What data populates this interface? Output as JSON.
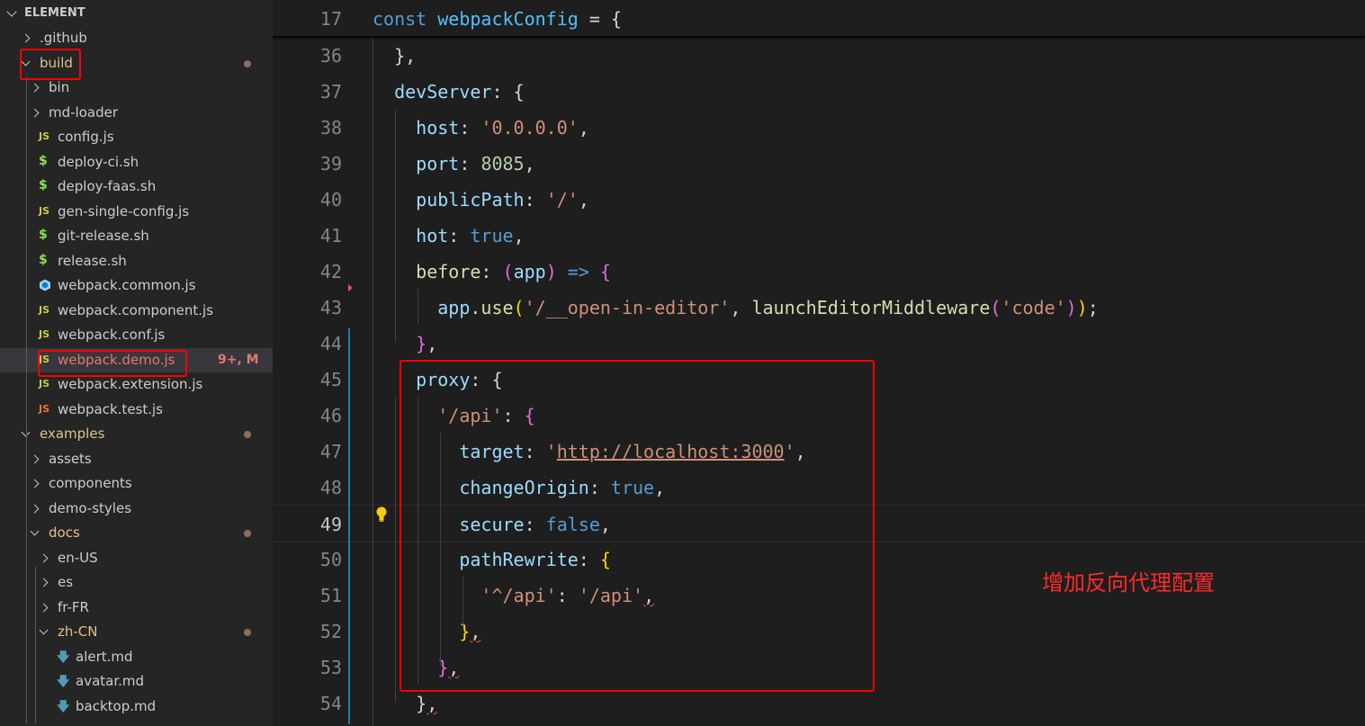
{
  "explorer": {
    "root": "ELEMENT",
    "items": [
      {
        "label": ".github",
        "type": "folder-closed",
        "indent": 0
      },
      {
        "label": "build",
        "type": "folder-open",
        "indent": 0,
        "modified_dot": true
      },
      {
        "label": "bin",
        "type": "folder-closed",
        "indent": 1
      },
      {
        "label": "md-loader",
        "type": "folder-closed",
        "indent": 1
      },
      {
        "label": "config.js",
        "type": "js",
        "indent": 1
      },
      {
        "label": "deploy-ci.sh",
        "type": "sh",
        "indent": 1
      },
      {
        "label": "deploy-faas.sh",
        "type": "sh",
        "indent": 1
      },
      {
        "label": "gen-single-config.js",
        "type": "js",
        "indent": 1
      },
      {
        "label": "git-release.sh",
        "type": "sh",
        "indent": 1
      },
      {
        "label": "release.sh",
        "type": "sh",
        "indent": 1
      },
      {
        "label": "webpack.common.js",
        "type": "webpack",
        "indent": 1
      },
      {
        "label": "webpack.component.js",
        "type": "js",
        "indent": 1
      },
      {
        "label": "webpack.conf.js",
        "type": "js",
        "indent": 1
      },
      {
        "label": "webpack.demo.js",
        "type": "js",
        "indent": 1,
        "active": true,
        "badge": "9+, M"
      },
      {
        "label": "webpack.extension.js",
        "type": "js",
        "indent": 1
      },
      {
        "label": "webpack.test.js",
        "type": "js-test",
        "indent": 1
      },
      {
        "label": "examples",
        "type": "folder-open",
        "indent": 0,
        "modified_dot": true
      },
      {
        "label": "assets",
        "type": "folder-closed",
        "indent": 1
      },
      {
        "label": "components",
        "type": "folder-closed",
        "indent": 1
      },
      {
        "label": "demo-styles",
        "type": "folder-closed",
        "indent": 1
      },
      {
        "label": "docs",
        "type": "folder-open",
        "indent": 1,
        "modified_dot": true
      },
      {
        "label": "en-US",
        "type": "folder-closed",
        "indent": 2
      },
      {
        "label": "es",
        "type": "folder-closed",
        "indent": 2
      },
      {
        "label": "fr-FR",
        "type": "folder-closed",
        "indent": 2
      },
      {
        "label": "zh-CN",
        "type": "folder-open",
        "indent": 2,
        "modified_dot": true
      },
      {
        "label": "alert.md",
        "type": "md",
        "indent": 3
      },
      {
        "label": "avatar.md",
        "type": "md",
        "indent": 3
      },
      {
        "label": "backtop.md",
        "type": "md",
        "indent": 3
      }
    ]
  },
  "icons": {
    "js": "JS",
    "sh": "$",
    "md": "🡇"
  },
  "colors": {
    "js": "#cbcb41",
    "js_test": "#e37933",
    "sh": "#89e051",
    "webpack": "#519aba",
    "md": "#519aba",
    "highlight_box": "#ff0000"
  },
  "editor": {
    "sticky_line": {
      "num": "17",
      "tokens": [
        [
          "const ",
          "k"
        ],
        [
          "webpackConfig",
          "v"
        ],
        [
          " = {",
          ""
        ]
      ]
    },
    "current_line": "49",
    "lines": [
      {
        "num": "36",
        "tokens": [
          [
            "  },",
            ""
          ]
        ]
      },
      {
        "num": "37",
        "tokens": [
          [
            "  ",
            ""
          ],
          [
            "devServer",
            "p"
          ],
          [
            ": {",
            ""
          ]
        ]
      },
      {
        "num": "38",
        "tokens": [
          [
            "    ",
            ""
          ],
          [
            "host",
            "p"
          ],
          [
            ": ",
            ""
          ],
          [
            "'0.0.0.0'",
            "s"
          ],
          [
            ",",
            ""
          ]
        ]
      },
      {
        "num": "39",
        "tokens": [
          [
            "    ",
            ""
          ],
          [
            "port",
            "p"
          ],
          [
            ": ",
            ""
          ],
          [
            "8085",
            "n"
          ],
          [
            ",",
            ""
          ]
        ]
      },
      {
        "num": "40",
        "tokens": [
          [
            "    ",
            ""
          ],
          [
            "publicPath",
            "p"
          ],
          [
            ": ",
            ""
          ],
          [
            "'/'",
            "s"
          ],
          [
            ",",
            ""
          ]
        ]
      },
      {
        "num": "41",
        "tokens": [
          [
            "    ",
            ""
          ],
          [
            "hot",
            "p"
          ],
          [
            ": ",
            ""
          ],
          [
            "true",
            "k"
          ],
          [
            ",",
            ""
          ]
        ]
      },
      {
        "num": "42",
        "tokens": [
          [
            "    ",
            ""
          ],
          [
            "before",
            "f"
          ],
          [
            ": ",
            ""
          ],
          [
            "(",
            "m"
          ],
          [
            "app",
            "p"
          ],
          [
            ")",
            "m"
          ],
          [
            " => ",
            "k"
          ],
          [
            "{",
            "m"
          ]
        ]
      },
      {
        "num": "43",
        "tokens": [
          [
            "      ",
            ""
          ],
          [
            "app",
            "p"
          ],
          [
            ".",
            ""
          ],
          [
            "use",
            "f"
          ],
          [
            "(",
            "y"
          ],
          [
            "'/__open-in-editor'",
            "s"
          ],
          [
            ", ",
            ""
          ],
          [
            "launchEditorMiddleware",
            "f"
          ],
          [
            "(",
            "m"
          ],
          [
            "'code'",
            "s"
          ],
          [
            ")",
            "m"
          ],
          [
            ")",
            "y"
          ],
          [
            ";",
            ""
          ]
        ]
      },
      {
        "num": "44",
        "tokens": [
          [
            "    ",
            ""
          ],
          [
            "}",
            "m"
          ],
          [
            ",",
            ""
          ]
        ]
      },
      {
        "num": "45",
        "tokens": [
          [
            "    ",
            ""
          ],
          [
            "proxy",
            "p"
          ],
          [
            ": {",
            ""
          ]
        ]
      },
      {
        "num": "46",
        "tokens": [
          [
            "      ",
            ""
          ],
          [
            "'/api'",
            "s"
          ],
          [
            ": ",
            ""
          ],
          [
            "{",
            "m"
          ]
        ]
      },
      {
        "num": "47",
        "tokens": [
          [
            "        ",
            ""
          ],
          [
            "target",
            "p"
          ],
          [
            ": ",
            ""
          ],
          [
            "'",
            "s"
          ],
          [
            "http://localhost:3000",
            "s url"
          ],
          [
            "'",
            "s"
          ],
          [
            ",",
            ""
          ]
        ]
      },
      {
        "num": "48",
        "tokens": [
          [
            "        ",
            ""
          ],
          [
            "changeOrigin",
            "p"
          ],
          [
            ": ",
            ""
          ],
          [
            "true",
            "k"
          ],
          [
            ",",
            ""
          ]
        ]
      },
      {
        "num": "49",
        "tokens": [
          [
            "        ",
            ""
          ],
          [
            "secure",
            "p"
          ],
          [
            ": ",
            ""
          ],
          [
            "false",
            "k"
          ],
          [
            ",",
            ""
          ]
        ]
      },
      {
        "num": "50",
        "tokens": [
          [
            "        ",
            ""
          ],
          [
            "pathRewrite",
            "p"
          ],
          [
            ": ",
            ""
          ],
          [
            "{",
            "y"
          ]
        ]
      },
      {
        "num": "51",
        "tokens": [
          [
            "          ",
            ""
          ],
          [
            "'^/api'",
            "s"
          ],
          [
            ": ",
            ""
          ],
          [
            "'/api'",
            "s"
          ],
          [
            ",",
            "squig"
          ]
        ]
      },
      {
        "num": "52",
        "tokens": [
          [
            "        ",
            ""
          ],
          [
            "}",
            "y"
          ],
          [
            ",",
            "squig"
          ]
        ]
      },
      {
        "num": "53",
        "tokens": [
          [
            "      ",
            ""
          ],
          [
            "}",
            "m"
          ],
          [
            ",",
            "squig"
          ]
        ]
      },
      {
        "num": "54",
        "tokens": [
          [
            "    ",
            ""
          ],
          [
            "}",
            ""
          ],
          [
            ",",
            "squig"
          ]
        ]
      }
    ],
    "annotation": "增加反向代理配置"
  }
}
